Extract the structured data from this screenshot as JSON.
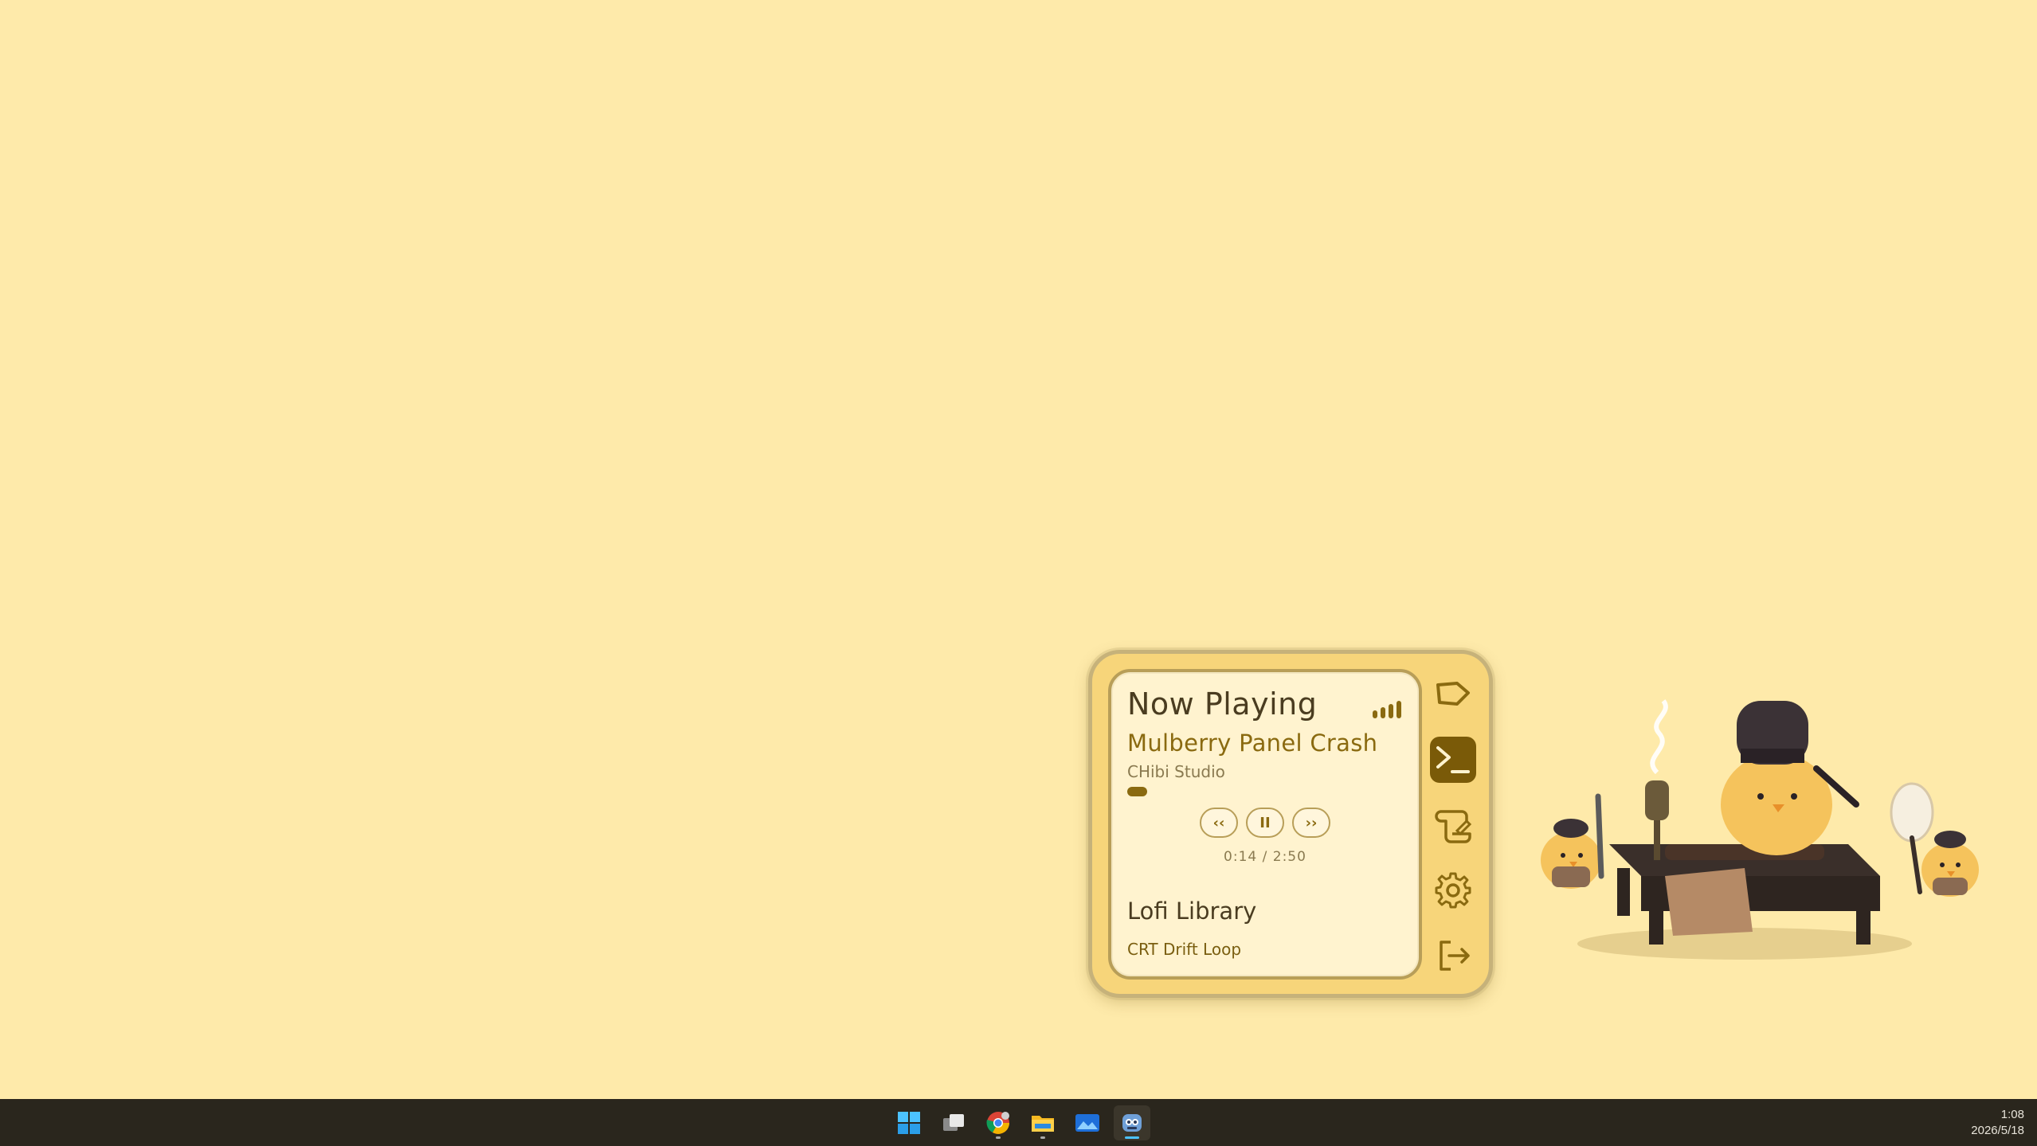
{
  "widget": {
    "header": "Now Playing",
    "track_title": "Mulberry Panel Crash",
    "artist": "CHibi Studio",
    "progress_fraction": 0.082,
    "controls": {
      "prev": "‹‹",
      "pause": "II",
      "next": "››"
    },
    "time": "0:14 / 2:50",
    "library_title": "Lofi Library",
    "library_items": [
      "CRT Drift Loop"
    ],
    "rail_icons": [
      "tag-icon",
      "terminal-icon",
      "scroll-icon",
      "gear-icon",
      "logout-icon"
    ],
    "active_rail": "terminal-icon"
  },
  "taskbar": {
    "apps": [
      "windows-start-icon",
      "task-view-icon",
      "chrome-icon",
      "file-explorer-icon",
      "photos-icon",
      "game-app-icon"
    ],
    "clock_time": "1:08",
    "clock_date": "2026/5/18"
  },
  "colors": {
    "desktop": "#feeaaa",
    "accent": "#8a6a10",
    "taskbar": "#2a261d"
  }
}
